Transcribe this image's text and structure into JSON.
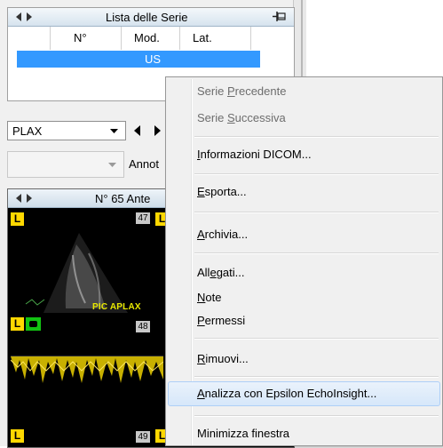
{
  "series_panel": {
    "title": "Lista delle Serie",
    "columns": [
      "N°",
      "Mod.",
      "Lat."
    ],
    "rows": [
      {
        "modality": "US"
      }
    ]
  },
  "view_select": {
    "value": "PLAX"
  },
  "annotation": {
    "label": "Annot"
  },
  "viewer": {
    "title": "N° 65 Ante",
    "badge": "L",
    "thumb_numbers": [
      "47",
      "48",
      "49"
    ],
    "image_label": "PIC APLAX"
  },
  "context_menu": {
    "items": [
      {
        "pre": "Serie ",
        "acc": "P",
        "post": "recedente",
        "enabled": false
      },
      {
        "pre": "Serie ",
        "acc": "S",
        "post": "uccessiva",
        "enabled": false
      },
      {
        "pre": "",
        "acc": "I",
        "post": "nformazioni DICOM...",
        "enabled": true
      },
      {
        "pre": "",
        "acc": "E",
        "post": "sporta...",
        "enabled": true
      },
      {
        "pre": "",
        "acc": "A",
        "post": "rchivia...",
        "enabled": true
      },
      {
        "pre": "All",
        "acc": "e",
        "post": "gati...",
        "enabled": true
      },
      {
        "pre": "",
        "acc": "N",
        "post": "ote",
        "enabled": true
      },
      {
        "pre": "",
        "acc": "P",
        "post": "ermessi",
        "enabled": true
      },
      {
        "pre": "",
        "acc": "R",
        "post": "imuovi...",
        "enabled": true
      },
      {
        "pre": "",
        "acc": "A",
        "post": "nalizza con Epsilon EchoInsight...",
        "enabled": true,
        "hover": true
      },
      {
        "pre": "Minimizza finestra",
        "acc": "",
        "post": "",
        "enabled": true
      }
    ]
  },
  "colors": {
    "selection": "#3399ff",
    "menu_hover": "#d6e7fa",
    "badge": "#ffd800",
    "image_label": "#e8e800"
  }
}
